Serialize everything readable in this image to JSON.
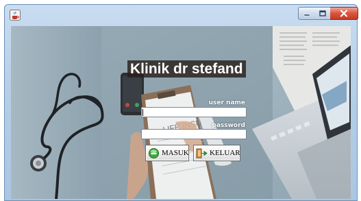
{
  "window": {
    "title": "",
    "controls": [
      "minimize",
      "maximize",
      "close"
    ]
  },
  "login": {
    "title": "Klinik dr stefand",
    "username_label": "user name",
    "username_value": "",
    "password_label": "password",
    "password_value": "",
    "login_button": "MASUK",
    "exit_button": "KELUAR"
  },
  "background": {
    "description_icons": [
      "stethoscope",
      "smartphone",
      "clipboard",
      "laptop",
      "newspaper"
    ],
    "colors": {
      "desk": "#a9bcc6",
      "wall_left": "#8ea4b0"
    }
  },
  "background_text": {
    "clipboard_text": "LIFE INSU"
  },
  "icons": {
    "app": "java-coffee-icon",
    "login": "green-circle-icon",
    "exit": "exit-arrow-icon"
  }
}
